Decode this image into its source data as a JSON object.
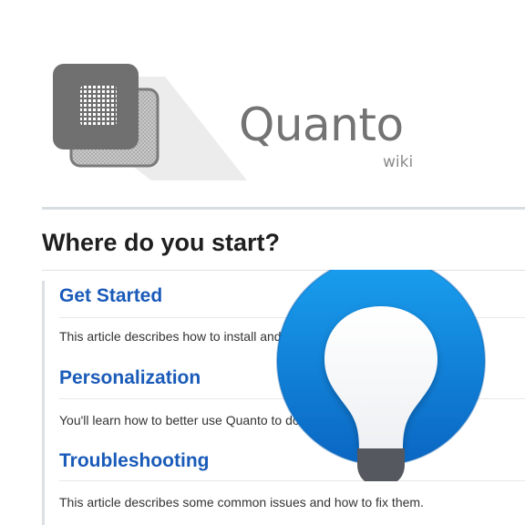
{
  "brand": {
    "name": "Quanto",
    "sub": "wiki",
    "logo_icon": "pixel-document-stack"
  },
  "page": {
    "title": "Where do you start?"
  },
  "sections": [
    {
      "title": "Get Started",
      "description": "This article describes how to install and"
    },
    {
      "title": "Personalization",
      "description": "You'll learn how to better use Quanto to do"
    },
    {
      "title": "Troubleshooting",
      "description": "This article describes some common issues and how to fix them."
    }
  ],
  "overlay": {
    "icon": "lightbulb-icon"
  },
  "colors": {
    "link": "#1a5bb9",
    "badge_blue": "#0a78d4",
    "bulb_base": "#5a5d63",
    "logo_gray": "#8a8a8a"
  }
}
